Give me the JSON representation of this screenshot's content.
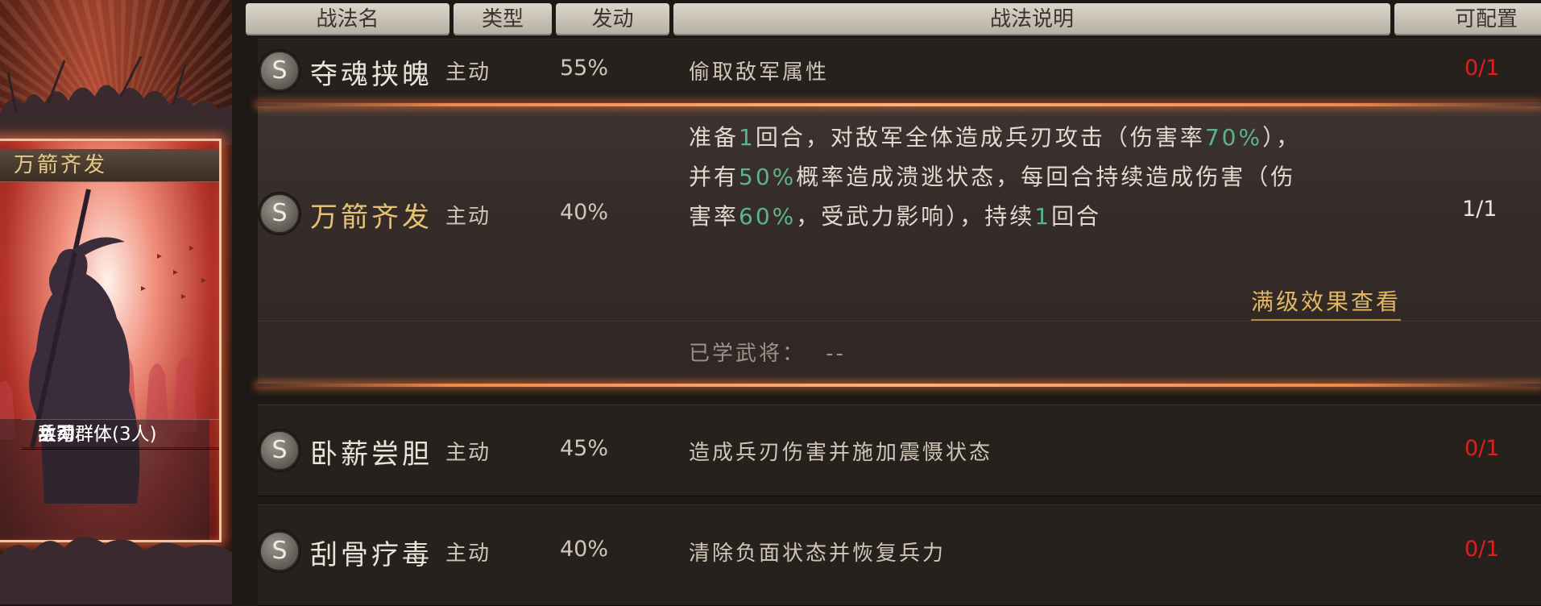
{
  "card": {
    "title": "万箭齐发",
    "info": [
      "主动",
      "兵刃群体",
      "敌军群体(3人)"
    ]
  },
  "table": {
    "headers": [
      "战法名",
      "类型",
      "发动",
      "战法说明",
      "可配置"
    ],
    "rows": [
      {
        "badge": "S",
        "name": "夺魂挟魄",
        "type": "主动",
        "rate": "55%",
        "desc": "偷取敌军属性",
        "count": "0/1"
      },
      {
        "badge": "S",
        "name": "卧薪尝胆",
        "type": "主动",
        "rate": "45%",
        "desc": "造成兵刃伤害并施加震慑状态",
        "count": "0/1"
      },
      {
        "badge": "S",
        "name": "刮骨疗毒",
        "type": "主动",
        "rate": "40%",
        "desc": "清除负面状态并恢复兵力",
        "count": "0/1"
      }
    ],
    "selected": {
      "badge": "S",
      "name": "万箭齐发",
      "type": "主动",
      "rate": "40%",
      "count": "1/1",
      "desc": {
        "p1": "准备",
        "v1": "1",
        "p2": "回合，对敌军全体造成兵刃攻击（伤害率",
        "v2": "70%",
        "p3": "），",
        "p4": "并有",
        "v3": "50%",
        "p5": "概率造成溃逃状态，每回合持续造成伤害（伤",
        "p6": "害率",
        "v4": "60%",
        "p7": "，受武力影响），持续",
        "v5": "1",
        "p8": "回合"
      },
      "full_effect_link": "满级效果查看",
      "learned_label": "已学武将：",
      "learned_value": "--"
    }
  },
  "colors": {
    "highlight_value": "#5cb58a",
    "unavailable_count": "#e01f1f",
    "link": "#e2b865",
    "selected_name": "#e6c075"
  }
}
